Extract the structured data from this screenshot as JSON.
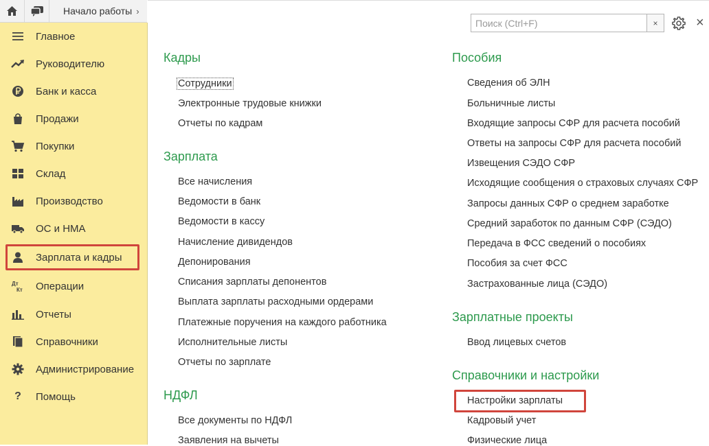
{
  "topbar": {
    "tab_label": "Начало работы",
    "tab_arrow": "›"
  },
  "sidebar": {
    "items": [
      {
        "label": "Главное",
        "icon": "menu-lines-icon"
      },
      {
        "label": "Руководителю",
        "icon": "trend-up-icon"
      },
      {
        "label": "Банк и касса",
        "icon": "ruble-coin-icon"
      },
      {
        "label": "Продажи",
        "icon": "shopping-bag-icon"
      },
      {
        "label": "Покупки",
        "icon": "cart-icon"
      },
      {
        "label": "Склад",
        "icon": "warehouse-grid-icon"
      },
      {
        "label": "Производство",
        "icon": "factory-icon"
      },
      {
        "label": "ОС и НМА",
        "icon": "truck-icon"
      },
      {
        "label": "Зарплата и кадры",
        "icon": "person-icon"
      },
      {
        "label": "Операции",
        "icon": "dt-kt-icon"
      },
      {
        "label": "Отчеты",
        "icon": "bar-chart-icon"
      },
      {
        "label": "Справочники",
        "icon": "books-icon"
      },
      {
        "label": "Администрирование",
        "icon": "gear-icon"
      },
      {
        "label": "Помощь",
        "icon": "question-icon"
      }
    ],
    "highlight_color": "#d0453c",
    "background": "#fbec9e"
  },
  "search": {
    "placeholder": "Поиск (Ctrl+F)",
    "value": "",
    "clear_label": "×"
  },
  "close_label": "×",
  "sections": {
    "kadry": {
      "title": "Кадры",
      "links": [
        "Сотрудники",
        "Электронные трудовые книжки",
        "Отчеты по кадрам"
      ]
    },
    "zarplata": {
      "title": "Зарплата",
      "links": [
        "Все начисления",
        "Ведомости в банк",
        "Ведомости в кассу",
        "Начисление дивидендов",
        "Депонирования",
        "Списания зарплаты депонентов",
        "Выплата зарплаты расходными ордерами",
        "Платежные поручения на каждого работника",
        "Исполнительные листы",
        "Отчеты по зарплате"
      ]
    },
    "ndfl": {
      "title": "НДФЛ",
      "links": [
        "Все документы по НДФЛ",
        "Заявления на вычеты"
      ]
    },
    "posobiya": {
      "title": "Пособия",
      "links": [
        "Сведения об ЭЛН",
        "Больничные листы",
        "Входящие запросы СФР для расчета пособий",
        "Ответы на запросы СФР для расчета пособий",
        "Извещения СЭДО СФР",
        "Исходящие сообщения о страховых случаях СФР",
        "Запросы данных СФР о среднем заработке",
        "Средний заработок по данным СФР (СЭДО)",
        "Передача в ФСС сведений о пособиях",
        "Пособия за счет ФСС",
        "Застрахованные лица (СЭДО)"
      ]
    },
    "zp_projects": {
      "title": "Зарплатные проекты",
      "links": [
        "Ввод лицевых счетов"
      ]
    },
    "spravochniki": {
      "title": "Справочники и настройки",
      "links": [
        "Настройки зарплаты",
        "Кадровый учет",
        "Физические лица"
      ]
    }
  },
  "colors": {
    "section_title": "#2d9a4d",
    "text": "#333333"
  }
}
